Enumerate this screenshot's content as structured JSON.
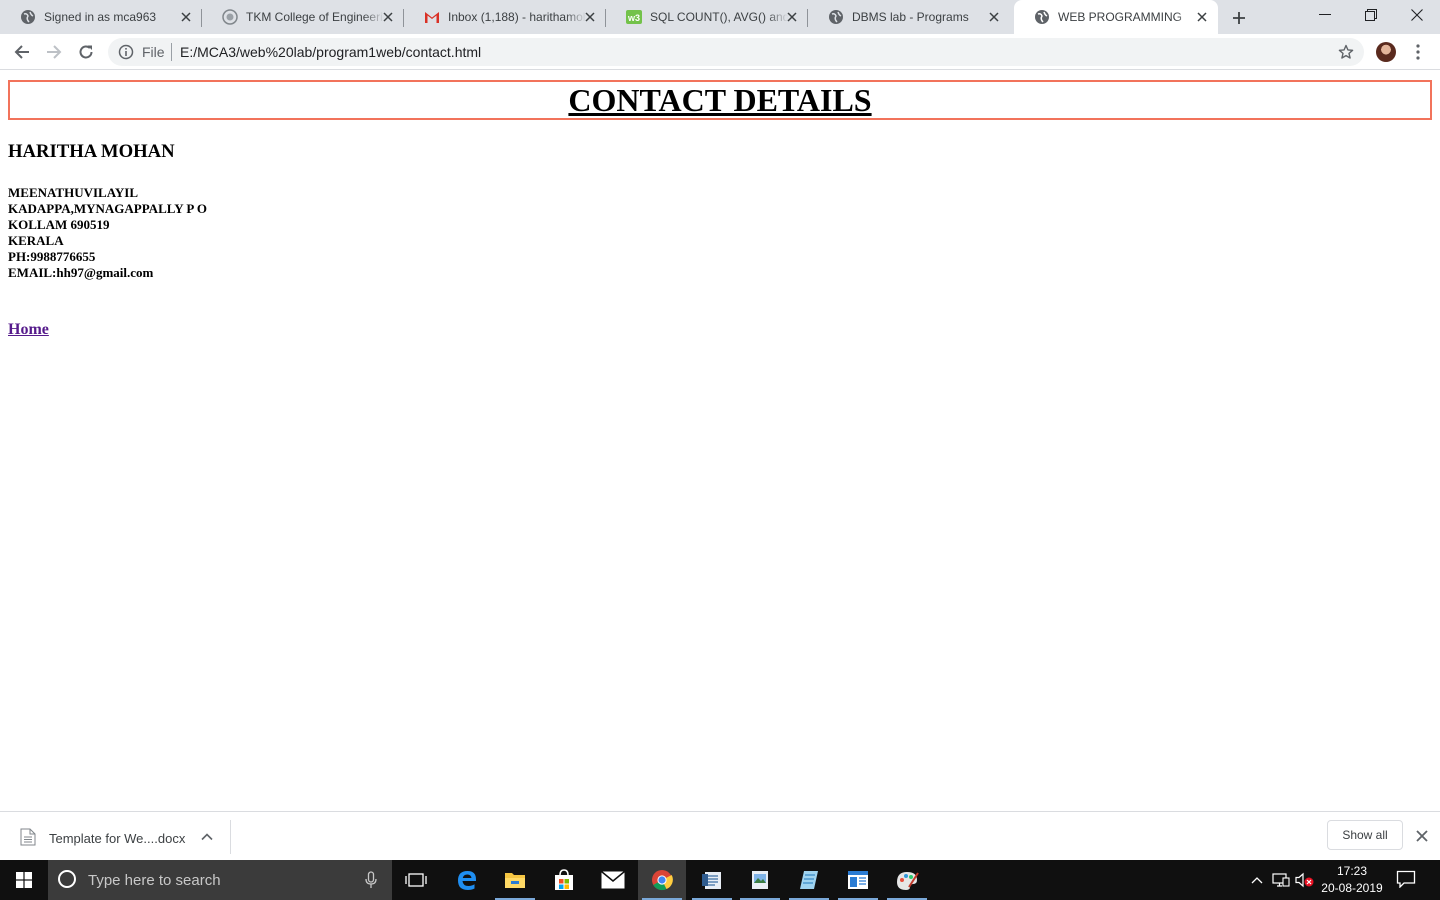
{
  "browser": {
    "tabs": [
      {
        "title": "Signed in as mca963",
        "icon": "globe-icon"
      },
      {
        "title": "TKM College of Engineering",
        "icon": "college-seal-icon"
      },
      {
        "title": "Inbox (1,188) - harithamohan",
        "icon": "gmail-icon"
      },
      {
        "title": "SQL COUNT(), AVG() and SUM()",
        "icon": "w3-icon"
      },
      {
        "title": "DBMS lab - Programs",
        "icon": "globe-icon"
      },
      {
        "title": "WEB PROGRAMMING",
        "icon": "globe-icon",
        "active": true
      }
    ],
    "omnibox": {
      "scheme_label": "File",
      "url": "E:/MCA3/web%20lab/program1web/contact.html"
    }
  },
  "page": {
    "heading": "CONTACT DETAILS",
    "name": "HARITHA MOHAN",
    "address_lines": [
      "MEENATHUVILAYIL",
      "KADAPPA,MYNAGAPPALLY P O",
      "KOLLAM 690519",
      "KERALA",
      "PH:9988776655",
      "EMAIL:hh97@gmail.com"
    ],
    "home_link": "Home"
  },
  "download_shelf": {
    "file_name": "Template for We....docx",
    "show_all_label": "Show all"
  },
  "taskbar": {
    "search_placeholder": "Type here to search",
    "time": "17:23",
    "date": "20-08-2019"
  },
  "colors": {
    "heading_border": "#f2735b",
    "visited_link": "#551a8b",
    "tab_strip": "#dee1e6",
    "taskbar": "#101010"
  }
}
